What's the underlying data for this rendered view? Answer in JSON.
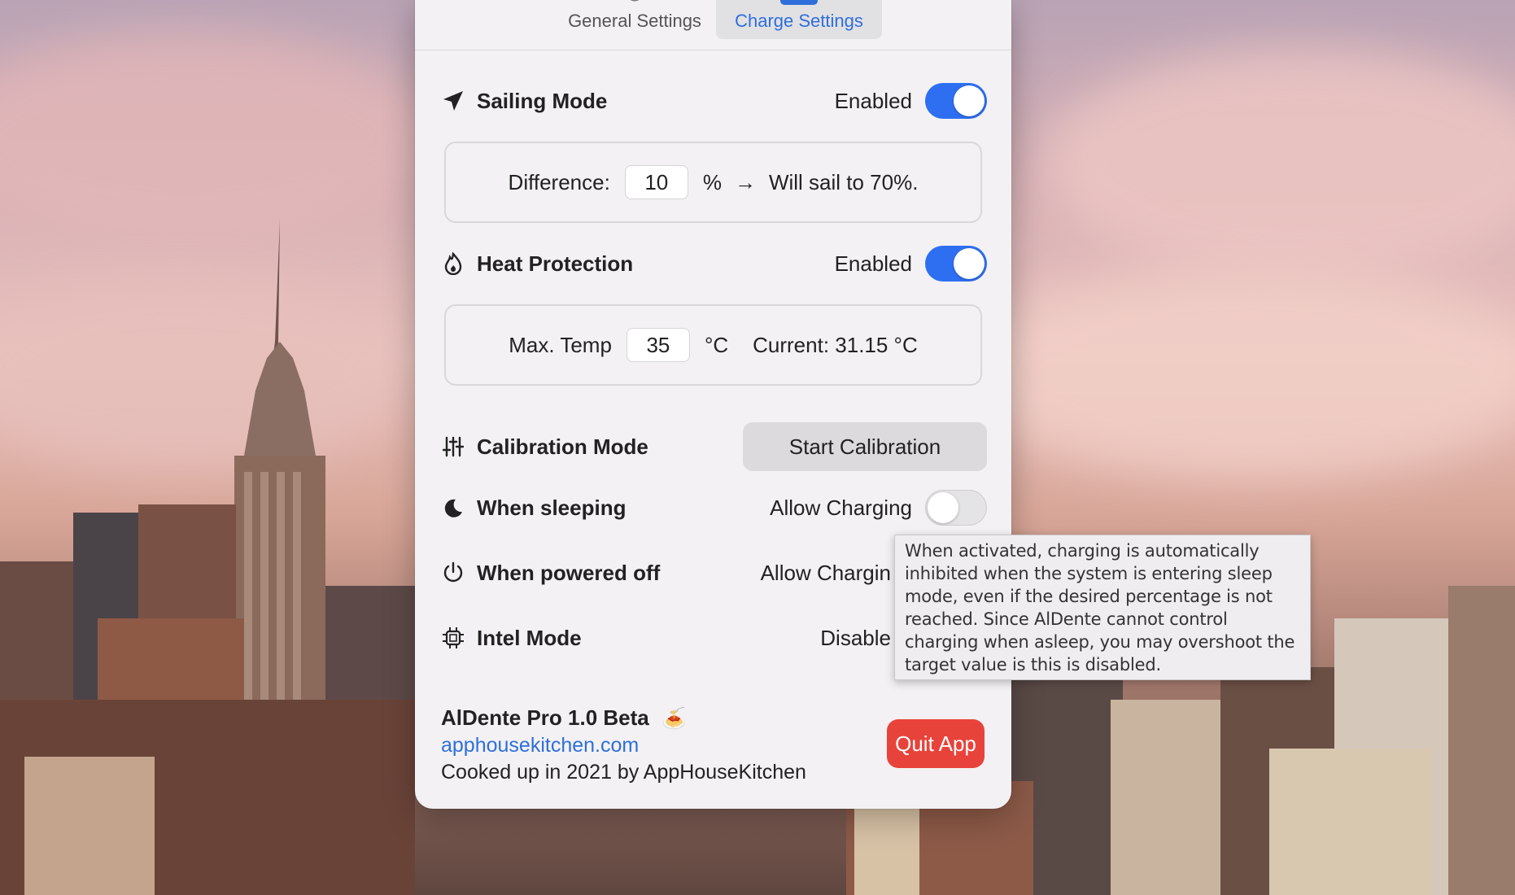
{
  "tabs": [
    {
      "label": "General Settings",
      "icon": "gear-icon",
      "active": false
    },
    {
      "label": "Charge Settings",
      "icon": "battery-icon",
      "active": true
    }
  ],
  "sailing": {
    "title": "Sailing Mode",
    "state": "Enabled",
    "enabled": true,
    "icon": "paper-plane-icon"
  },
  "difference": {
    "label": "Difference:",
    "value": "10",
    "unit": "%",
    "arrow": "→",
    "result": "Will sail to 70%."
  },
  "heat": {
    "title": "Heat Protection",
    "state": "Enabled",
    "enabled": true,
    "icon": "flame-icon"
  },
  "temp": {
    "label": "Max. Temp",
    "value": "35",
    "unit": "°C",
    "current": "Current: 31.15 °C"
  },
  "calibration": {
    "title": "Calibration Mode",
    "button": "Start Calibration",
    "icon": "sliders-icon"
  },
  "sleeping": {
    "title": "When sleeping",
    "state": "Allow Charging",
    "enabled": false,
    "icon": "moon-icon"
  },
  "powered_off": {
    "title": "When powered off",
    "state": "Allow Chargin",
    "icon": "power-icon"
  },
  "intel": {
    "title": "Intel Mode",
    "state": "Disable",
    "icon": "chip-icon"
  },
  "footer": {
    "app_name": "AlDente Pro 1.0 Beta",
    "emoji": "🍝",
    "link": "apphousekitchen.com",
    "credit": "Cooked up in 2021 by AppHouseKitchen",
    "quit": "Quit App"
  },
  "tooltip": {
    "lines": [
      "When activated, charging is automatically",
      "inhibited when the system is entering sleep",
      "mode, even if the desired percentage is not",
      "reached. Since AlDente cannot control",
      "charging when asleep, you may overshoot the",
      "target value is this is disabled."
    ]
  },
  "colors": {
    "accent": "#2e6ff2",
    "link": "#2e6fdc",
    "quit": "#e8433b",
    "panel": "#f3f1f3"
  }
}
